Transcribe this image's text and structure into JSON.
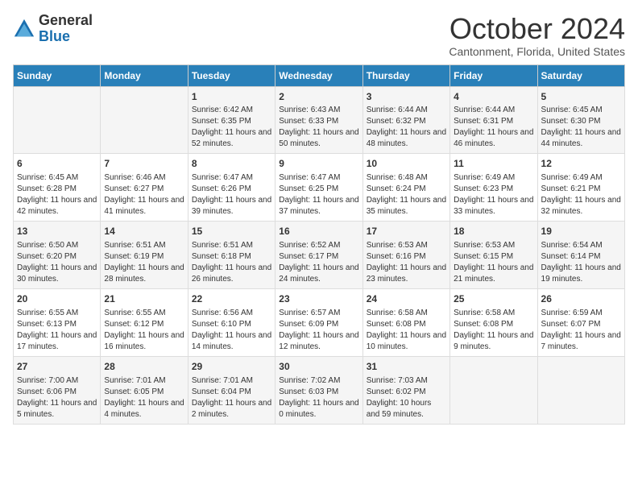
{
  "logo": {
    "general": "General",
    "blue": "Blue"
  },
  "title": "October 2024",
  "location": "Cantonment, Florida, United States",
  "days_header": [
    "Sunday",
    "Monday",
    "Tuesday",
    "Wednesday",
    "Thursday",
    "Friday",
    "Saturday"
  ],
  "weeks": [
    [
      {
        "day": "",
        "info": ""
      },
      {
        "day": "",
        "info": ""
      },
      {
        "day": "1",
        "info": "Sunrise: 6:42 AM\nSunset: 6:35 PM\nDaylight: 11 hours and 52 minutes."
      },
      {
        "day": "2",
        "info": "Sunrise: 6:43 AM\nSunset: 6:33 PM\nDaylight: 11 hours and 50 minutes."
      },
      {
        "day": "3",
        "info": "Sunrise: 6:44 AM\nSunset: 6:32 PM\nDaylight: 11 hours and 48 minutes."
      },
      {
        "day": "4",
        "info": "Sunrise: 6:44 AM\nSunset: 6:31 PM\nDaylight: 11 hours and 46 minutes."
      },
      {
        "day": "5",
        "info": "Sunrise: 6:45 AM\nSunset: 6:30 PM\nDaylight: 11 hours and 44 minutes."
      }
    ],
    [
      {
        "day": "6",
        "info": "Sunrise: 6:45 AM\nSunset: 6:28 PM\nDaylight: 11 hours and 42 minutes."
      },
      {
        "day": "7",
        "info": "Sunrise: 6:46 AM\nSunset: 6:27 PM\nDaylight: 11 hours and 41 minutes."
      },
      {
        "day": "8",
        "info": "Sunrise: 6:47 AM\nSunset: 6:26 PM\nDaylight: 11 hours and 39 minutes."
      },
      {
        "day": "9",
        "info": "Sunrise: 6:47 AM\nSunset: 6:25 PM\nDaylight: 11 hours and 37 minutes."
      },
      {
        "day": "10",
        "info": "Sunrise: 6:48 AM\nSunset: 6:24 PM\nDaylight: 11 hours and 35 minutes."
      },
      {
        "day": "11",
        "info": "Sunrise: 6:49 AM\nSunset: 6:23 PM\nDaylight: 11 hours and 33 minutes."
      },
      {
        "day": "12",
        "info": "Sunrise: 6:49 AM\nSunset: 6:21 PM\nDaylight: 11 hours and 32 minutes."
      }
    ],
    [
      {
        "day": "13",
        "info": "Sunrise: 6:50 AM\nSunset: 6:20 PM\nDaylight: 11 hours and 30 minutes."
      },
      {
        "day": "14",
        "info": "Sunrise: 6:51 AM\nSunset: 6:19 PM\nDaylight: 11 hours and 28 minutes."
      },
      {
        "day": "15",
        "info": "Sunrise: 6:51 AM\nSunset: 6:18 PM\nDaylight: 11 hours and 26 minutes."
      },
      {
        "day": "16",
        "info": "Sunrise: 6:52 AM\nSunset: 6:17 PM\nDaylight: 11 hours and 24 minutes."
      },
      {
        "day": "17",
        "info": "Sunrise: 6:53 AM\nSunset: 6:16 PM\nDaylight: 11 hours and 23 minutes."
      },
      {
        "day": "18",
        "info": "Sunrise: 6:53 AM\nSunset: 6:15 PM\nDaylight: 11 hours and 21 minutes."
      },
      {
        "day": "19",
        "info": "Sunrise: 6:54 AM\nSunset: 6:14 PM\nDaylight: 11 hours and 19 minutes."
      }
    ],
    [
      {
        "day": "20",
        "info": "Sunrise: 6:55 AM\nSunset: 6:13 PM\nDaylight: 11 hours and 17 minutes."
      },
      {
        "day": "21",
        "info": "Sunrise: 6:55 AM\nSunset: 6:12 PM\nDaylight: 11 hours and 16 minutes."
      },
      {
        "day": "22",
        "info": "Sunrise: 6:56 AM\nSunset: 6:10 PM\nDaylight: 11 hours and 14 minutes."
      },
      {
        "day": "23",
        "info": "Sunrise: 6:57 AM\nSunset: 6:09 PM\nDaylight: 11 hours and 12 minutes."
      },
      {
        "day": "24",
        "info": "Sunrise: 6:58 AM\nSunset: 6:08 PM\nDaylight: 11 hours and 10 minutes."
      },
      {
        "day": "25",
        "info": "Sunrise: 6:58 AM\nSunset: 6:08 PM\nDaylight: 11 hours and 9 minutes."
      },
      {
        "day": "26",
        "info": "Sunrise: 6:59 AM\nSunset: 6:07 PM\nDaylight: 11 hours and 7 minutes."
      }
    ],
    [
      {
        "day": "27",
        "info": "Sunrise: 7:00 AM\nSunset: 6:06 PM\nDaylight: 11 hours and 5 minutes."
      },
      {
        "day": "28",
        "info": "Sunrise: 7:01 AM\nSunset: 6:05 PM\nDaylight: 11 hours and 4 minutes."
      },
      {
        "day": "29",
        "info": "Sunrise: 7:01 AM\nSunset: 6:04 PM\nDaylight: 11 hours and 2 minutes."
      },
      {
        "day": "30",
        "info": "Sunrise: 7:02 AM\nSunset: 6:03 PM\nDaylight: 11 hours and 0 minutes."
      },
      {
        "day": "31",
        "info": "Sunrise: 7:03 AM\nSunset: 6:02 PM\nDaylight: 10 hours and 59 minutes."
      },
      {
        "day": "",
        "info": ""
      },
      {
        "day": "",
        "info": ""
      }
    ]
  ]
}
